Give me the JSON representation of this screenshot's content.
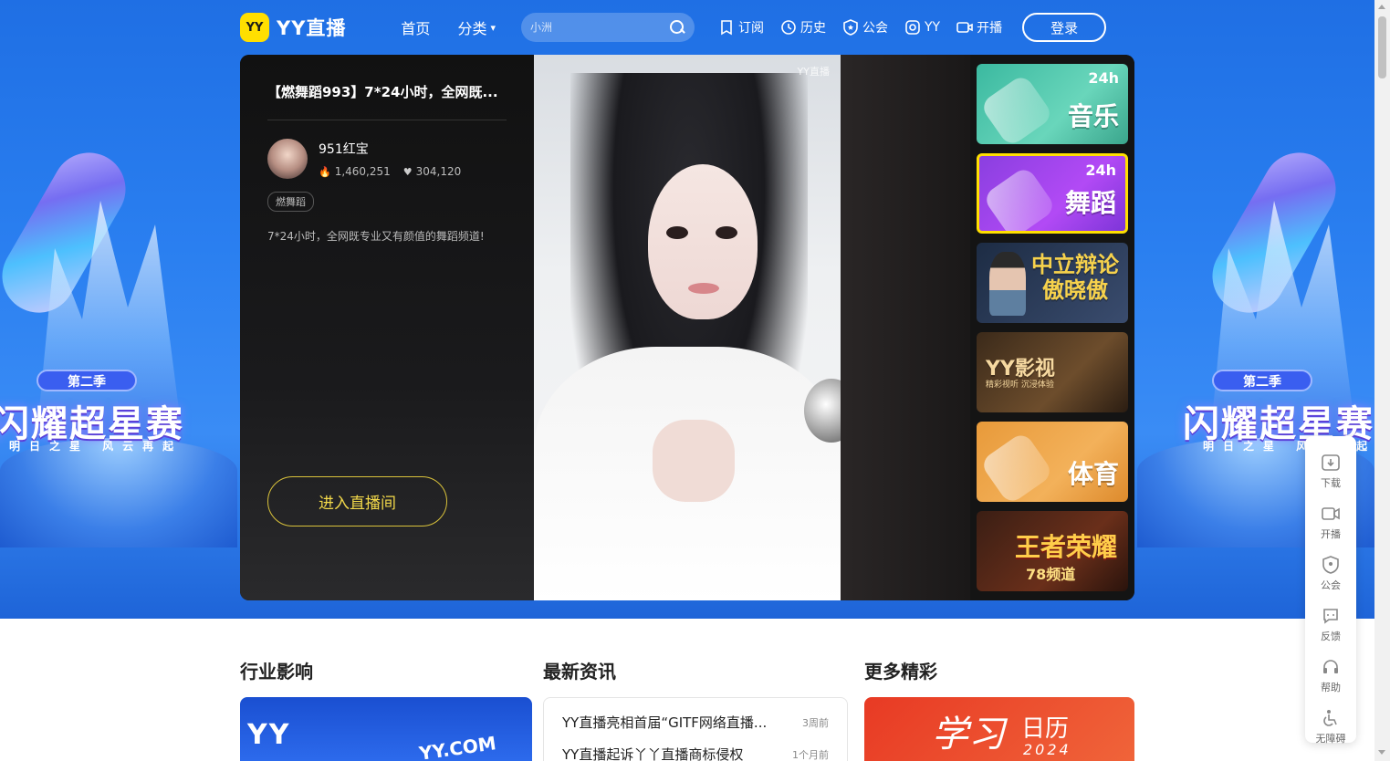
{
  "header": {
    "logo_badge": "YY",
    "logo_text": "YY直播",
    "nav": [
      {
        "label": "首页"
      },
      {
        "label": "分类"
      }
    ],
    "search_placeholder": "小洲",
    "tools": [
      {
        "label": "订阅",
        "icon": "bookmark-icon"
      },
      {
        "label": "历史",
        "icon": "clock-icon"
      },
      {
        "label": "公会",
        "icon": "shield-star-icon"
      },
      {
        "label": "YY",
        "icon": "yy-app-icon"
      },
      {
        "label": "开播",
        "icon": "camera-icon"
      }
    ],
    "login_label": "登录"
  },
  "banner": {
    "season": "第二季",
    "title": "闪耀超星赛",
    "subtitle": "明日之星 风云再起"
  },
  "player": {
    "title": "【燃舞蹈993】7*24小时，全网既...",
    "streamer_name": "951红宝",
    "heat": "1,460,251",
    "likes": "304,120",
    "tag": "燃舞蹈",
    "description": "7*24小时，全网既专业又有颜值的舞蹈频道!",
    "enter_label": "进入直播间",
    "watermark": "YY直播"
  },
  "channels": [
    {
      "name": "音乐",
      "top": "24h",
      "theme": "music"
    },
    {
      "name": "舞蹈",
      "top": "24h",
      "theme": "dance",
      "active": true
    },
    {
      "name": "中立辩论 傲晓傲",
      "theme": "debate"
    },
    {
      "name": "YY影视",
      "sub": "精彩视听 沉浸体验",
      "theme": "film"
    },
    {
      "name": "体育",
      "theme": "sports"
    },
    {
      "name": "王者荣耀",
      "sub": "78频道",
      "theme": "game"
    }
  ],
  "sections": {
    "industry": "行业影响",
    "news_title": "最新资讯",
    "more": "更多精彩"
  },
  "industry_card": {
    "brand": "YY",
    "domain": "YY.COM"
  },
  "news": [
    {
      "title": "YY直播亮相首届“GITF网络直播...",
      "date": "3周前"
    },
    {
      "title": "YY直播起诉丫丫直播商标侵权",
      "date": "1个月前"
    }
  ],
  "calendar_card": {
    "main": "学习",
    "word": "日历",
    "year": "2024"
  },
  "float_menu": [
    {
      "label": "下载",
      "icon": "download-icon"
    },
    {
      "label": "开播",
      "icon": "camera-icon"
    },
    {
      "label": "公会",
      "icon": "shield-star-icon"
    },
    {
      "label": "反馈",
      "icon": "feedback-icon"
    },
    {
      "label": "帮助",
      "icon": "headset-icon"
    },
    {
      "label": "无障碍",
      "icon": "accessibility-icon"
    }
  ],
  "colors": {
    "brand_yellow": "#ffdf00",
    "hero_blue": "#2a7ff0",
    "enter_gold": "#f3d94a"
  }
}
